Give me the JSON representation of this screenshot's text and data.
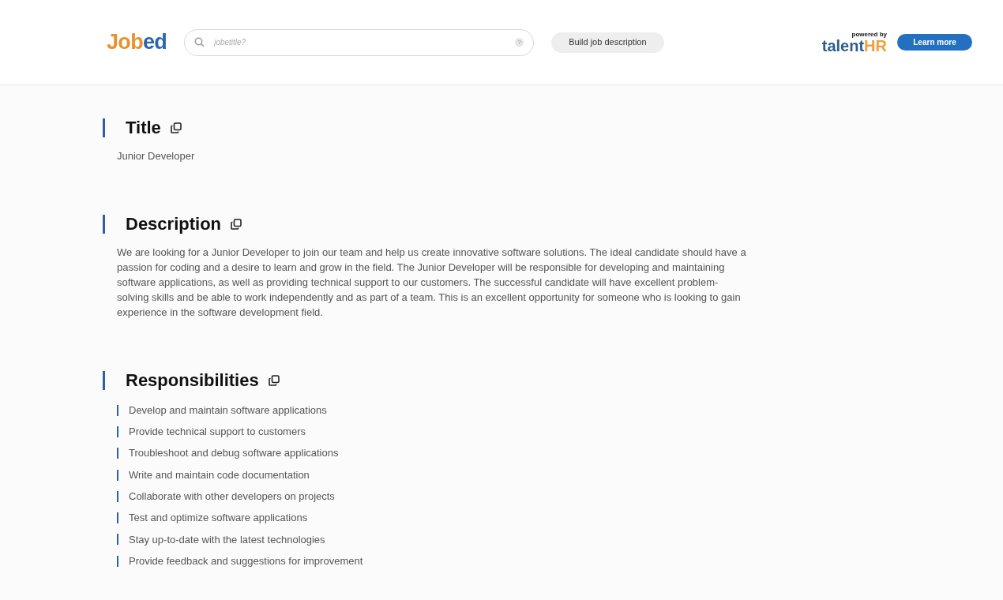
{
  "header": {
    "logo": [
      "Job",
      "ed"
    ],
    "search": {
      "placeholder": "jobetitle?",
      "help": "?"
    },
    "build_button": "Build job description",
    "powered_by": "powered by",
    "partner_logo": [
      "talent",
      "HR"
    ],
    "learn_more": "Learn more"
  },
  "sections": [
    {
      "kind": "text",
      "heading": "Title",
      "body": "Junior Developer"
    },
    {
      "kind": "text",
      "heading": "Description",
      "body": "We are looking for a Junior Developer to join our team and help us create innovative software solutions. The ideal candidate should have a passion for coding and a desire to learn and grow in the field. The Junior Developer will be responsible for developing and maintaining software applications, as well as providing technical support to our customers. The successful candidate will have excellent problem-solving skills and  be able to work independently and as part of a team. This is an excellent opportunity for someone who is  looking to gain experience in the software development field."
    },
    {
      "kind": "list",
      "heading": "Responsibilities",
      "items": [
        "Develop and maintain software applications",
        "Provide technical support to customers",
        "Troubleshoot and debug software applications",
        "Write and maintain code documentation",
        "Collaborate with other developers on projects",
        "Test and optimize software applications",
        "Stay up-to-date with the latest technologies",
        "Provide feedback and suggestions for improvement"
      ]
    }
  ]
}
